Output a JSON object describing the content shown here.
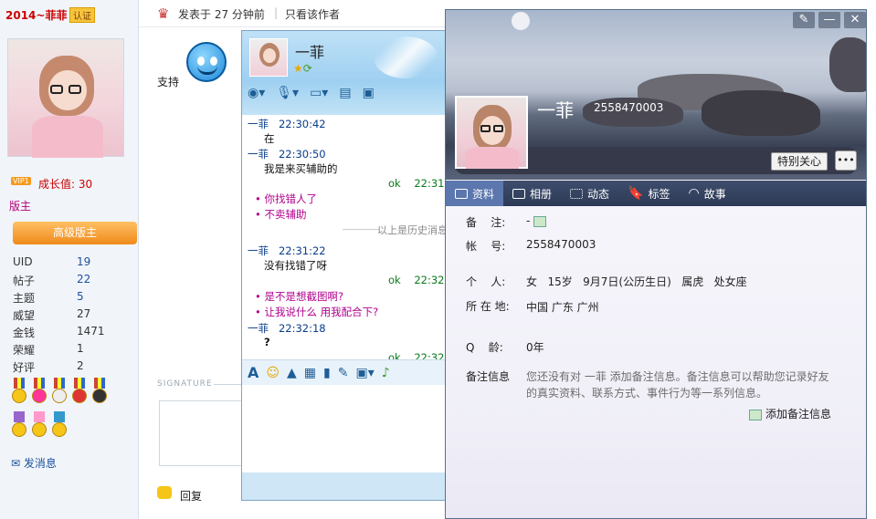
{
  "sidebar": {
    "username": "2014~菲菲",
    "cert_badge": "认证",
    "vip_badge": "VIP1",
    "growth": "成长值: 30",
    "role": "版主",
    "rank_button": "高级版主",
    "stats": [
      {
        "key": "UID",
        "value": "19"
      },
      {
        "key": "帖子",
        "value": "22"
      },
      {
        "key": "主题",
        "value": "5"
      },
      {
        "key": "威望",
        "value": "27"
      },
      {
        "key": "金钱",
        "value": "1471"
      },
      {
        "key": "荣耀",
        "value": "1"
      },
      {
        "key": "好评",
        "value": "2"
      }
    ],
    "send_message": "发消息"
  },
  "post": {
    "posted_at": "发表于 27 分钟前",
    "only_author": "只看该作者",
    "content": "支持",
    "signature_label": "SIGNATURE",
    "reply": "回复"
  },
  "chat": {
    "contact_name": "一菲",
    "messages": [
      {
        "sender": "一菲",
        "time": "22:30:42",
        "text": "在"
      },
      {
        "sender": "一菲",
        "time": "22:30:50",
        "text": "我是来买辅助的"
      },
      {
        "sender": "ok",
        "time": "22:31",
        "text": ""
      },
      {
        "sender": "",
        "time": "",
        "text": "你找错人了"
      },
      {
        "sender": "",
        "time": "",
        "text": "不卖辅助"
      },
      {
        "sender": "",
        "time": "",
        "text": "以上是历史消息"
      },
      {
        "sender": "一菲",
        "time": "22:31:22",
        "text": "没有找错了呀"
      },
      {
        "sender": "ok",
        "time": "22:32",
        "text": ""
      },
      {
        "sender": "",
        "time": "",
        "text": "是不是想截图啊?"
      },
      {
        "sender": "",
        "time": "",
        "text": "让我说什么  用我配合下?"
      },
      {
        "sender": "一菲",
        "time": "22:32:18",
        "text": "?"
      },
      {
        "sender": "ok",
        "time": "22:32",
        "text": ""
      }
    ]
  },
  "profile": {
    "name": "一菲",
    "qq_number": "2558470003",
    "special_care": "特别关心",
    "tabs": [
      "资料",
      "相册",
      "动态",
      "标签",
      "故事"
    ],
    "fields": [
      {
        "label": "备    注:",
        "value": "-"
      },
      {
        "label": "帐    号:",
        "value": "2558470003"
      },
      {
        "label": "个    人:",
        "value": "女   15岁   9月7日(公历生日)   属虎   处女座"
      },
      {
        "label": "所 在 地:",
        "value": "中国 广东 广州"
      },
      {
        "label": "Q    龄:",
        "value": "0年"
      },
      {
        "label": "备注信息",
        "value": ""
      }
    ],
    "note_text": "您还没有对 一菲 添加备注信息。备注信息可以帮助您记录好友的真实资料、联系方式、事件行为等一系列信息。",
    "add_note": "添加备注信息"
  }
}
